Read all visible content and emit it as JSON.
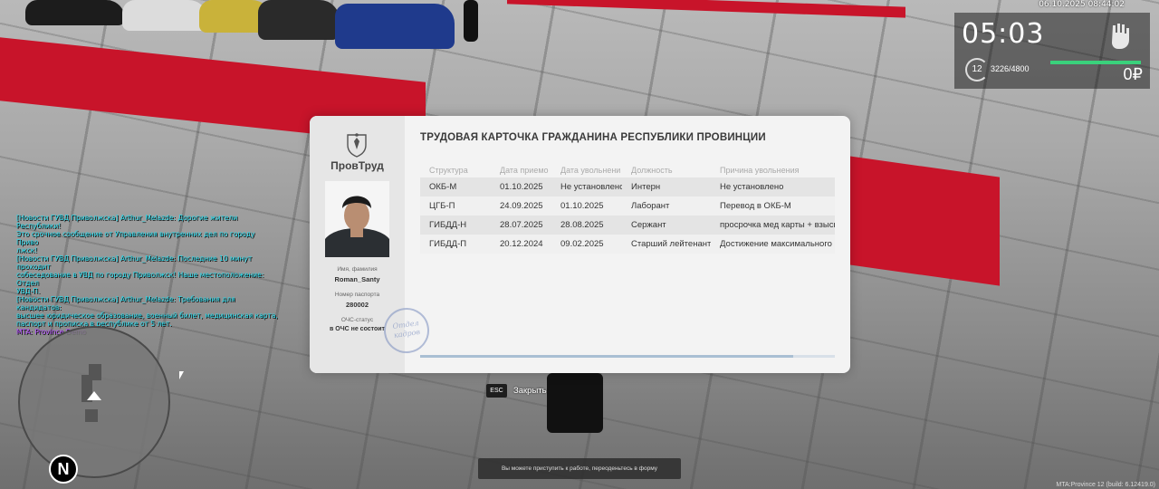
{
  "hud": {
    "datetime": "06.10.2025 08:44:02",
    "time": "05:03",
    "level": "12",
    "exp": "3226/4800",
    "money": "0₽"
  },
  "chat": {
    "lines": [
      {
        "text": "[Новости ГУВД Приволжска] Arthur_Melazde: Дорогие жители Республики!",
        "kind": "news"
      },
      {
        "text": "Это срочное сообщение от Управления внутренних дел по городу Приво",
        "kind": "news"
      },
      {
        "text": "лжск!",
        "kind": "news"
      },
      {
        "text": "[Новости ГУВД Приволжска] Arthur_Melazde: Последние 10 минут проходит",
        "kind": "news"
      },
      {
        "text": " собеседование в УВД по городу Приволжск! Наше местоположение: Отдел",
        "kind": "news"
      },
      {
        "text": "УВД-П.",
        "kind": "news"
      },
      {
        "text": "[Новости ГУВД Приволжска] Arthur_Melazde: Требования для кандидатов:",
        "kind": "news"
      },
      {
        "text": " высшее юридическое образование, военный билет, медицинская карта,",
        "kind": "news"
      },
      {
        "text": "паспорт и прописка в республике от 5 лет.",
        "kind": "news"
      },
      {
        "text": "MTA: Province Demo",
        "kind": "server"
      }
    ]
  },
  "card": {
    "org_name": "ПровТруд",
    "title": "ТРУДОВАЯ КАРТОЧКА ГРАЖДАНИНА РЕСПУБЛИКИ ПРОВИНЦИИ",
    "name_label": "Имя, фамилия",
    "name_value": "Roman_Santy",
    "passport_label": "Номер паспорта",
    "passport_value": "280002",
    "och_label": "ОЧС-статус",
    "och_value": "в ОЧС не состоит",
    "stamp_text": "Отдел кадров",
    "columns": [
      "Структура",
      "Дата приемо",
      "Дата увольнени",
      "Должность",
      "Причина увольнения"
    ],
    "rows": [
      [
        "ОКБ-М",
        "01.10.2025",
        "Не установлено",
        "Интерн",
        "Не установлено"
      ],
      [
        "ЦГБ-П",
        "24.09.2025",
        "01.10.2025",
        "Лаборант",
        "Перевод в ОКБ-М"
      ],
      [
        "ГИБДД-Н",
        "28.07.2025",
        "28.08.2025",
        "Сержант",
        "просрочка мед карты + взыск"
      ],
      [
        "ГИБДД-П",
        "20.12.2024",
        "09.02.2025",
        "Старший лейтенант",
        "Достижение максимального"
      ]
    ],
    "scroll_fraction": 0.9
  },
  "close": {
    "key": "ESC",
    "label": "Закрыть"
  },
  "notice": "Вы можете приступить к работе, переоденьтесь в форму",
  "build": "MTA:Province 12 (build: 6.12419.0)",
  "radar": {
    "north": "N"
  },
  "colors": {
    "hud_bar": "#3ad17b",
    "news": "#27d8ea",
    "server": "#b24cff",
    "carpet": "#c8142a"
  }
}
